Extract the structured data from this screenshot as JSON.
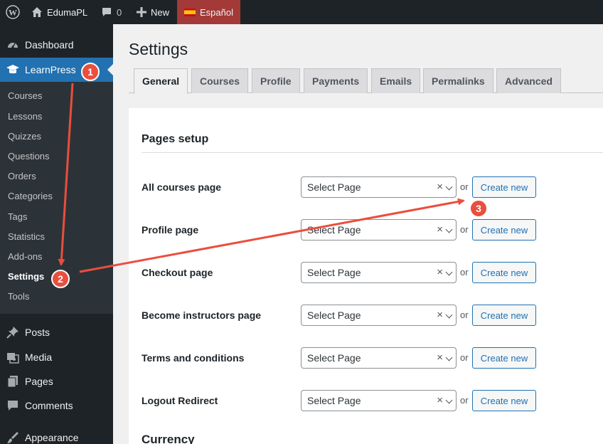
{
  "adminbar": {
    "site_name": "EdumaPL",
    "comments_count": "0",
    "new_label": "New",
    "language": "Español"
  },
  "sidebar": {
    "dashboard": "Dashboard",
    "learnpress": "LearnPress",
    "submenu": [
      "Courses",
      "Lessons",
      "Quizzes",
      "Questions",
      "Orders",
      "Categories",
      "Tags",
      "Statistics",
      "Add-ons",
      "Settings",
      "Tools"
    ],
    "posts": "Posts",
    "media": "Media",
    "pages": "Pages",
    "comments": "Comments",
    "appearance": "Appearance"
  },
  "main": {
    "title": "Settings",
    "tabs": [
      "General",
      "Courses",
      "Profile",
      "Payments",
      "Emails",
      "Permalinks",
      "Advanced"
    ],
    "section_title": "Pages setup",
    "rows": [
      {
        "label": "All courses page",
        "select": "Select Page",
        "or": "or",
        "button": "Create new"
      },
      {
        "label": "Profile page",
        "select": "Select Page",
        "or": "or",
        "button": "Create new"
      },
      {
        "label": "Checkout page",
        "select": "Select Page",
        "or": "or",
        "button": "Create new"
      },
      {
        "label": "Become instructors page",
        "select": "Select Page",
        "or": "or",
        "button": "Create new"
      },
      {
        "label": "Terms and conditions",
        "select": "Select Page",
        "or": "or",
        "button": "Create new"
      },
      {
        "label": "Logout Redirect",
        "select": "Select Page",
        "or": "or",
        "button": "Create new"
      }
    ],
    "next_section": "Currency"
  },
  "annotations": [
    "1",
    "2",
    "3"
  ],
  "colors": {
    "accent": "#2271b1",
    "annotation": "#ea4e3d",
    "adminbar": "#1d2327"
  }
}
